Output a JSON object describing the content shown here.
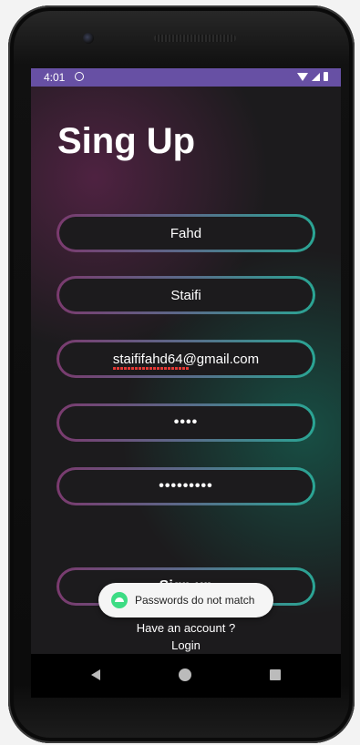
{
  "status_bar": {
    "time": "4:01"
  },
  "page": {
    "title": "Sing Up"
  },
  "form": {
    "first_name": "Fahd",
    "last_name": "Staifi",
    "email": "staififahd64@gmail.com",
    "password": "••••",
    "confirm_password": "•••••••••",
    "signup_label": "Sign up"
  },
  "toast": {
    "message": "Passwords do not match"
  },
  "footer": {
    "have_account": "Have an account ?",
    "login_label": "Login"
  },
  "colors": {
    "status_bar": "#6750a4",
    "border_start": "#7a3a6e",
    "border_end": "#2aa594",
    "toast_icon": "#3ddc84"
  },
  "icons": [
    "back-icon",
    "home-icon",
    "recents-icon",
    "toast-app-icon",
    "wifi-icon",
    "signal-icon",
    "battery-icon"
  ]
}
